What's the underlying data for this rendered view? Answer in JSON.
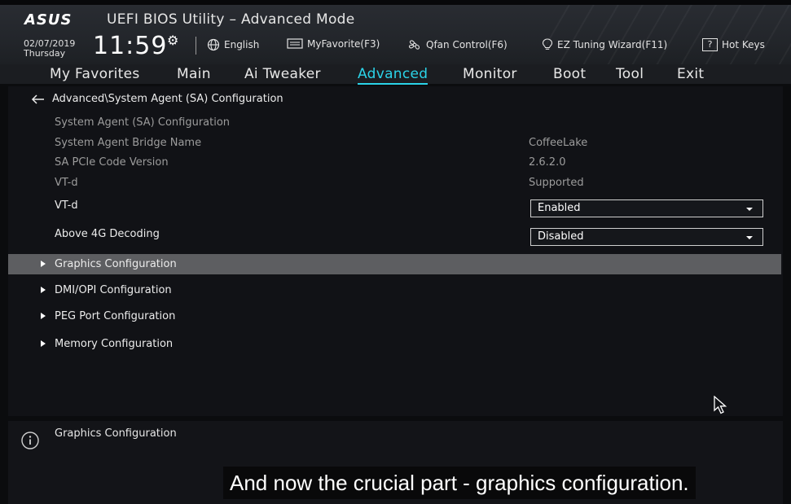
{
  "header": {
    "logo": "ASUS",
    "title": "UEFI BIOS Utility – Advanced Mode",
    "date": "02/07/2019",
    "weekday": "Thursday",
    "time": "11:59",
    "tools": [
      {
        "label": "English",
        "icon": "globe-icon"
      },
      {
        "label": "MyFavorite(F3)",
        "icon": "monitor-icon"
      },
      {
        "label": "Qfan Control(F6)",
        "icon": "fan-icon"
      },
      {
        "label": "EZ Tuning Wizard(F11)",
        "icon": "lightbulb-icon"
      },
      {
        "label": "Hot Keys",
        "icon": "help-key-icon",
        "key": "?"
      }
    ]
  },
  "nav": {
    "tabs": [
      "My Favorites",
      "Main",
      "Ai Tweaker",
      "Advanced",
      "Monitor",
      "Boot",
      "Tool",
      "Exit"
    ],
    "active": "Advanced"
  },
  "main": {
    "breadcrumb": "Advanced\\System Agent (SA) Configuration",
    "section_title": "System Agent (SA) Configuration",
    "info_rows": [
      {
        "label": "System Agent Bridge Name",
        "value": "CoffeeLake"
      },
      {
        "label": "SA PCIe Code Version",
        "value": "2.6.2.0"
      },
      {
        "label": "VT-d",
        "value": "Supported"
      }
    ],
    "settings": [
      {
        "label": "VT-d",
        "value": "Enabled"
      },
      {
        "label": "Above 4G Decoding",
        "value": "Disabled"
      }
    ],
    "submenus": [
      "Graphics Configuration",
      "DMI/OPI Configuration",
      "PEG Port Configuration",
      "Memory Configuration"
    ],
    "selected_submenu": "Graphics Configuration"
  },
  "help": {
    "text": "Graphics Configuration"
  },
  "subtitle": "And now the crucial part - graphics configuration.",
  "colors": {
    "accent": "#2bd3e8",
    "selected_row": "#5d5e61"
  }
}
